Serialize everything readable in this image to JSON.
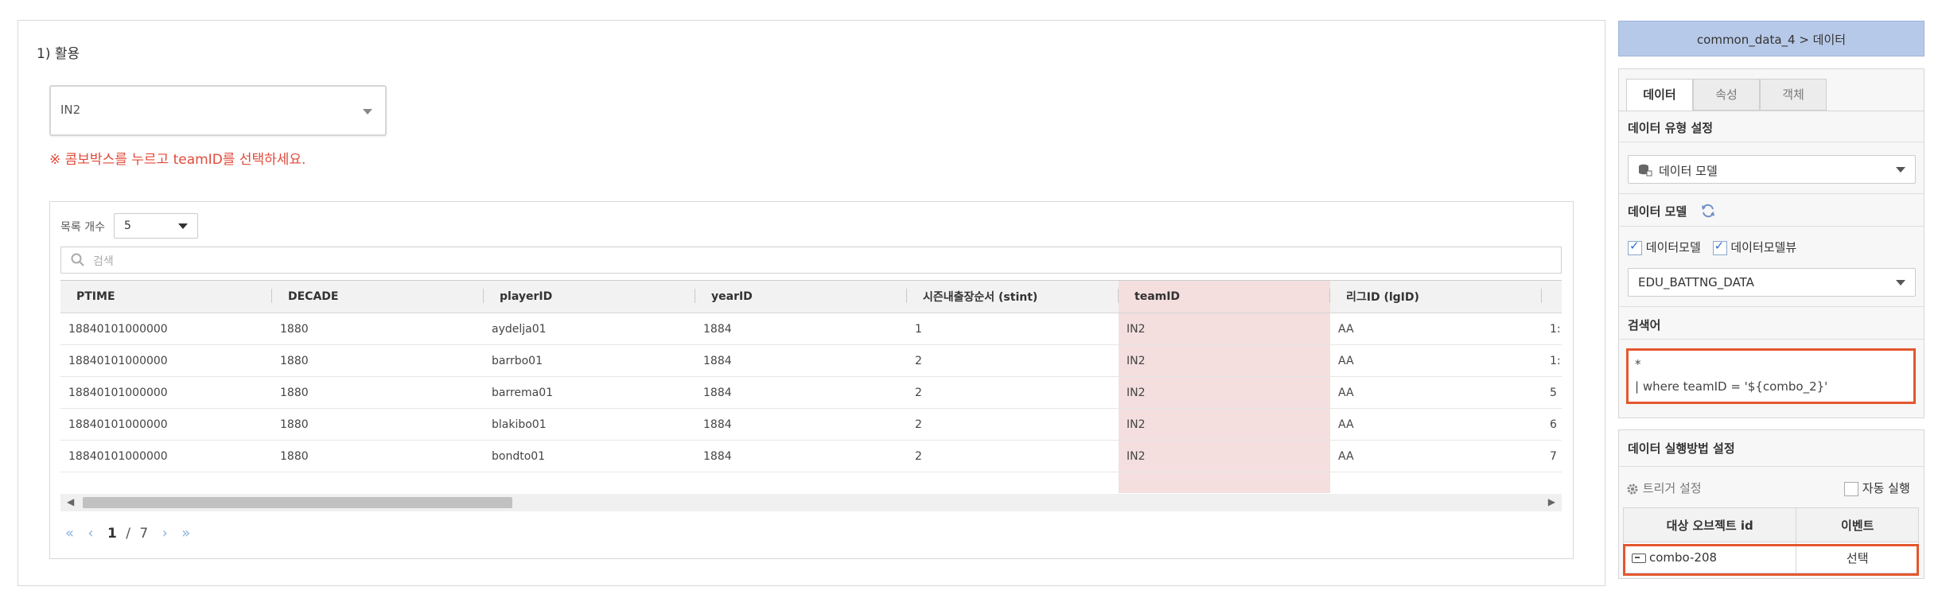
{
  "main": {
    "section_title": "1) 활용",
    "combo_value": "IN2",
    "warning": "※ 콤보박스를 누르고 teamID를 선택하세요.",
    "grid": {
      "count_label": "목록 개수",
      "count_value": "5",
      "search_placeholder": "검색",
      "columns": [
        "PTIME",
        "DECADE",
        "playerID",
        "yearID",
        "시즌내출장순서 (stint)",
        "teamID",
        "리그ID (lgID)",
        ""
      ],
      "rows": [
        [
          "18840101000000",
          "1880",
          "aydelja01",
          "1884",
          "1",
          "IN2",
          "AA",
          "1:"
        ],
        [
          "18840101000000",
          "1880",
          "barrbo01",
          "1884",
          "2",
          "IN2",
          "AA",
          "1:"
        ],
        [
          "18840101000000",
          "1880",
          "barrema01",
          "1884",
          "2",
          "IN2",
          "AA",
          "5"
        ],
        [
          "18840101000000",
          "1880",
          "blakibo01",
          "1884",
          "2",
          "IN2",
          "AA",
          "6"
        ],
        [
          "18840101000000",
          "1880",
          "bondto01",
          "1884",
          "2",
          "IN2",
          "AA",
          "7"
        ]
      ],
      "highlight_color": "#f4dede"
    },
    "pager": {
      "first": "«",
      "prev": "‹",
      "current": "1",
      "sep": "/",
      "total": "7",
      "next": "›",
      "last": "»"
    }
  },
  "right": {
    "breadcrumb": "common_data_4 > 데이터",
    "tabs": [
      "데이터",
      "속성",
      "객체"
    ],
    "data_type_label": "데이터 유형 설정",
    "data_type_value": "데이터 모델",
    "data_model_label": "데이터 모델",
    "check1": "데이터모델",
    "check2": "데이터모델뷰",
    "model_value": "EDU_BATTNG_DATA",
    "query_label": "검색어",
    "query_line1": "*",
    "query_line2": "| where teamID = '${combo_2}'",
    "exec_label": "데이터 실행방법 설정",
    "trigger_label": "트리거 설정",
    "auto_label": "자동 실행",
    "evt_cols": [
      "대상 오브젝트 id",
      "이벤트"
    ],
    "evt_row": [
      "combo-208",
      "선택"
    ],
    "accent": "#e4572e",
    "header_bg": "#b7c9e8"
  }
}
